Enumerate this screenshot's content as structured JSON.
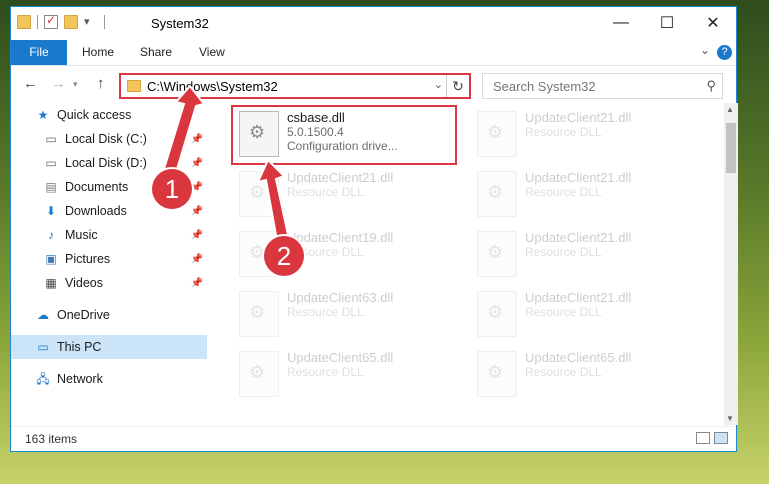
{
  "window": {
    "title": "System32",
    "ribbon_tabs": [
      "File",
      "Home",
      "Share",
      "View"
    ],
    "help": "?"
  },
  "navigation": {
    "back": "←",
    "forward": "→",
    "up": "↑",
    "address_path": "C:\\Windows\\System32",
    "search_placeholder": "Search System32"
  },
  "sidebar": {
    "items": [
      {
        "label": "Quick access",
        "icon": "star-icon",
        "pinned": false
      },
      {
        "label": "Local Disk (C:)",
        "icon": "drive-icon",
        "pinned": true
      },
      {
        "label": "Local Disk (D:)",
        "icon": "drive-icon",
        "pinned": true
      },
      {
        "label": "Documents",
        "icon": "documents-icon",
        "pinned": true
      },
      {
        "label": "Downloads",
        "icon": "download-icon",
        "pinned": true
      },
      {
        "label": "Music",
        "icon": "music-icon",
        "pinned": true
      },
      {
        "label": "Pictures",
        "icon": "pictures-icon",
        "pinned": true
      },
      {
        "label": "Videos",
        "icon": "videos-icon",
        "pinned": true
      },
      {
        "label": "OneDrive",
        "icon": "cloud-icon",
        "pinned": false
      },
      {
        "label": "This PC",
        "icon": "computer-icon",
        "pinned": false,
        "selected": true
      },
      {
        "label": "Network",
        "icon": "network-icon",
        "pinned": false
      }
    ]
  },
  "files": {
    "highlighted": {
      "name": "csbase.dll",
      "version": "5.0.1500.4",
      "type": "Configuration drive..."
    },
    "faded": [
      {
        "name": "UpdateClient21.dll",
        "type": "Resource DLL"
      },
      {
        "name": "UpdateClient21.dll",
        "type": "Resource DLL"
      },
      {
        "name": "UpdateClient21.dll",
        "type": "Resource DLL"
      },
      {
        "name": "UpdateClient19.dll",
        "type": "Resource DLL"
      },
      {
        "name": "UpdateClient21.dll",
        "type": "Resource DLL"
      },
      {
        "name": "UpdateClient63.dll",
        "type": "Resource DLL"
      },
      {
        "name": "UpdateClient21.dll",
        "type": "Resource DLL"
      },
      {
        "name": "UpdateClient65.dll",
        "type": "Resource DLL"
      },
      {
        "name": "UpdateClient65.dll",
        "type": "Resource DLL"
      }
    ]
  },
  "status": {
    "item_count": "163 items"
  },
  "callouts": [
    "1",
    "2"
  ],
  "colors": {
    "accent": "#1979ca",
    "highlight": "#d9363e",
    "selected_bg": "#cce4f7"
  }
}
